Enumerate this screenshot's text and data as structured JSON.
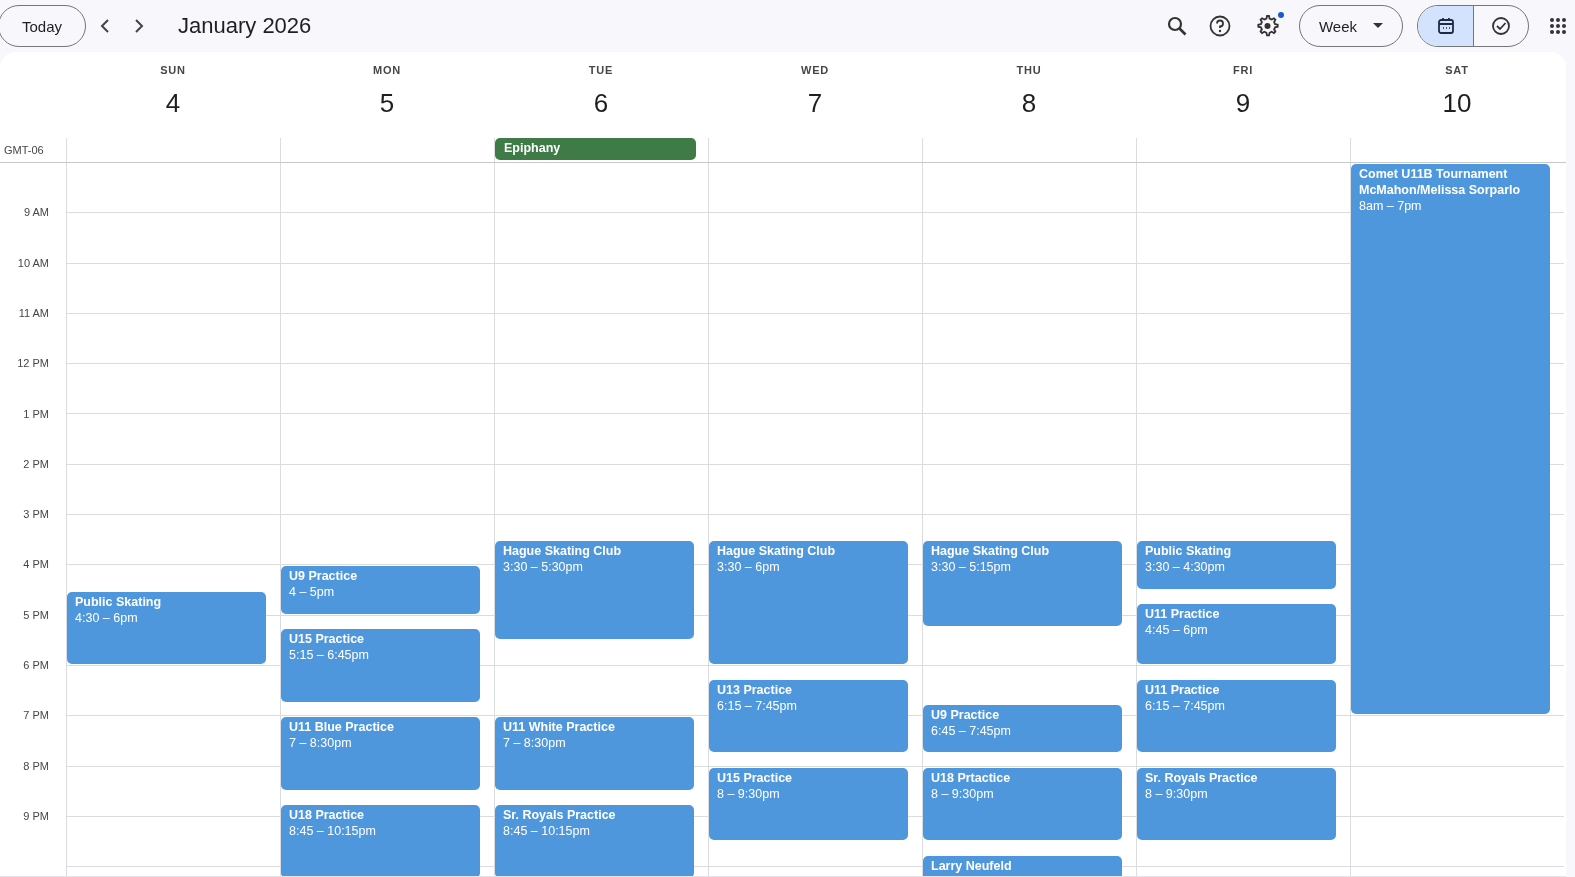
{
  "toolbar": {
    "today_button": "Today",
    "title": "January 2026",
    "settings_notification": true,
    "view_button": "Week",
    "mode_tabs": [
      {
        "kind": "calendar",
        "selected": true
      },
      {
        "kind": "tasks",
        "selected": false
      }
    ]
  },
  "timezone": "GMT-06",
  "hour_labels": [
    "9 AM",
    "10 AM",
    "11 AM",
    "12 PM",
    "1 PM",
    "2 PM",
    "3 PM",
    "4 PM",
    "5 PM",
    "6 PM",
    "7 PM",
    "8 PM",
    "9 PM"
  ],
  "days": [
    {
      "weekday": "SUN",
      "date": "4",
      "events": [
        {
          "title": "Public Skating",
          "time": "4:30 – 6pm",
          "color": "#4f97dc"
        }
      ]
    },
    {
      "weekday": "MON",
      "date": "5",
      "events": [
        {
          "title": "U9 Practice",
          "time": "4 – 5pm",
          "color": "#4f97dc"
        },
        {
          "title": "U15 Practice",
          "time": "5:15 – 6:45pm",
          "color": "#4f97dc"
        },
        {
          "title": "U11 Blue Practice",
          "time": "7 – 8:30pm",
          "color": "#4f97dc"
        },
        {
          "title": "U18 Practice",
          "time": "8:45 – 10:15pm",
          "color": "#4f97dc"
        }
      ]
    },
    {
      "weekday": "TUE",
      "date": "6",
      "all_day": [
        {
          "title": "Epiphany",
          "color": "#3e7b47"
        }
      ],
      "events": [
        {
          "title": "Hague Skating Club",
          "time": "3:30 – 5:30pm",
          "color": "#4f97dc"
        },
        {
          "title": "U11 White Practice",
          "time": "7 – 8:30pm",
          "color": "#4f97dc"
        },
        {
          "title": "Sr. Royals Practice",
          "time": "8:45 – 10:15pm",
          "color": "#4f97dc"
        }
      ]
    },
    {
      "weekday": "WED",
      "date": "7",
      "events": [
        {
          "title": "Hague Skating Club",
          "time": "3:30 – 6pm",
          "color": "#4f97dc"
        },
        {
          "title": "U13 Practice",
          "time": "6:15 – 7:45pm",
          "color": "#4f97dc"
        },
        {
          "title": "U15 Practice",
          "time": "8 – 9:30pm",
          "color": "#4f97dc"
        }
      ]
    },
    {
      "weekday": "THU",
      "date": "8",
      "events": [
        {
          "title": "Hague Skating Club",
          "time": "3:30 – 5:15pm",
          "color": "#4f97dc"
        },
        {
          "title": "U9 Practice",
          "time": "6:45 – 7:45pm",
          "color": "#4f97dc"
        },
        {
          "title": "U18 Prtactice",
          "time": "8 – 9:30pm",
          "color": "#4f97dc"
        },
        {
          "title": "Larry Neufeld",
          "color": "#4f97dc"
        }
      ]
    },
    {
      "weekday": "FRI",
      "date": "9",
      "events": [
        {
          "title": "Public Skating",
          "time": "3:30 – 4:30pm",
          "color": "#4f97dc"
        },
        {
          "title": "U11 Practice",
          "time": "4:45 – 6pm",
          "color": "#4f97dc"
        },
        {
          "title": "U11 Practice",
          "time": "6:15 – 7:45pm",
          "color": "#4f97dc"
        },
        {
          "title": "Sr. Royals Practice",
          "time": "8 – 9:30pm",
          "color": "#4f97dc"
        }
      ]
    },
    {
      "weekday": "SAT",
      "date": "10",
      "events": [
        {
          "title": "Comet U11B Tournament McMahon/Melissa Sorparlo",
          "time": "8am – 7pm",
          "color": "#4f97dc"
        }
      ]
    }
  ]
}
